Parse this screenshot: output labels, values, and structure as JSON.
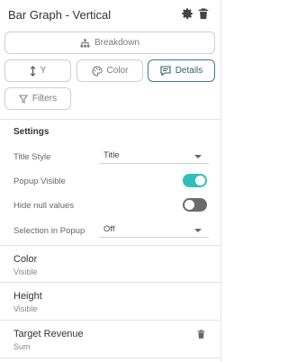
{
  "header": {
    "title": "Bar Graph - Vertical"
  },
  "buttons": {
    "breakdown": "Breakdown",
    "y": "Y",
    "color": "Color",
    "details": "Details",
    "filters": "Filters"
  },
  "settings": {
    "heading": "Settings",
    "title_style": {
      "label": "Title Style",
      "value": "Title"
    },
    "popup_visible": {
      "label": "Popup Visible",
      "on": true
    },
    "hide_null": {
      "label": "Hide null values",
      "on": false
    },
    "selection_popup": {
      "label": "Selection in Popup",
      "value": "Off"
    }
  },
  "fields": [
    {
      "name": "Color",
      "sub": "Visible"
    },
    {
      "name": "Height",
      "sub": "Visible"
    },
    {
      "name": "Target Revenue",
      "sub": "Sum"
    }
  ],
  "colors": {
    "accent": "#2fbfbe",
    "selected_border": "#3f7a8a",
    "toggle_off": "#6b6b6b"
  }
}
